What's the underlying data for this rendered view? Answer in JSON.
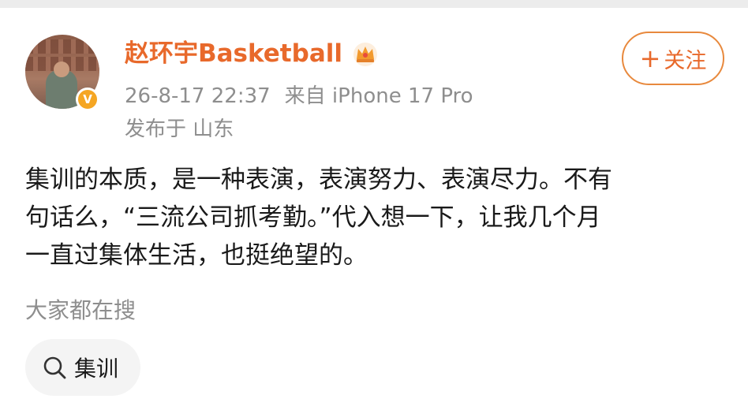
{
  "post": {
    "username": "赵环宇Basketball",
    "datetime": "26-8-17 22:37",
    "source": "来自 iPhone 17 Pro",
    "location": "发布于 山东",
    "follow_label": "关注",
    "body_lines": [
      "集训的本质，是一种表演，表演努力、表演尽力。不有",
      "句话么，“三流公司抓考勤。”代入想一下，让我几个月",
      "一直过集体生活，也挺绝望的。"
    ]
  },
  "related_search": {
    "title": "大家都在搜",
    "items": [
      {
        "label": "集训"
      }
    ]
  },
  "icons": {
    "verified_badge": "verified-v-icon",
    "vip": "crown-icon",
    "follow": "plus-icon",
    "search": "search-icon"
  },
  "colors": {
    "username": "#e8692b",
    "follow_border": "#e8893d",
    "meta_text": "#8e8e8e",
    "chip_background": "#f4f4f4",
    "verified_badge": "#f5a623"
  }
}
